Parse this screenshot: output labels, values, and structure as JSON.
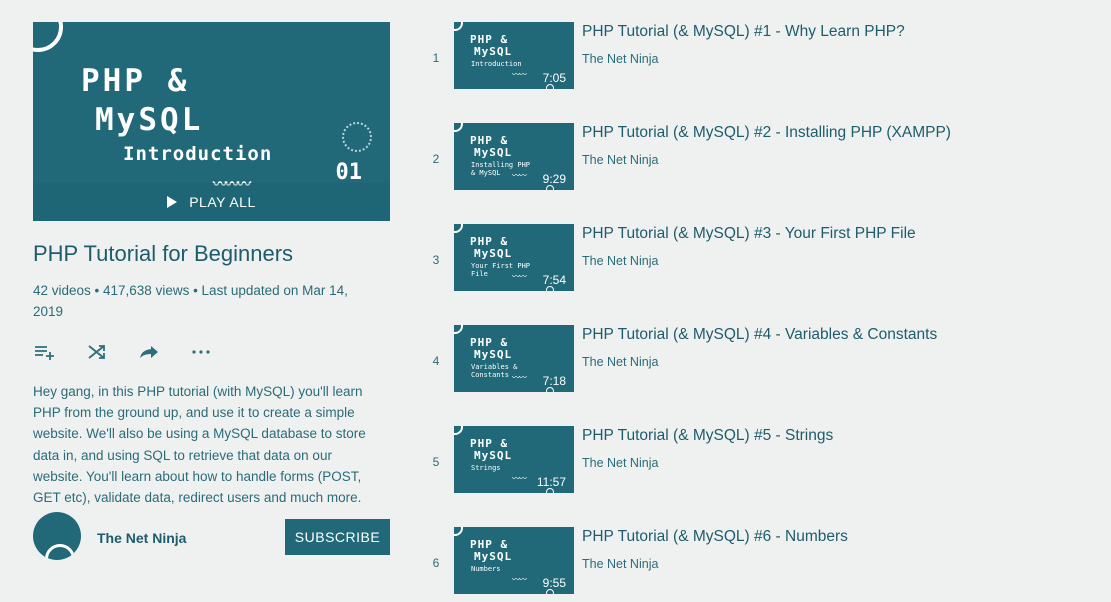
{
  "playlist": {
    "hero": {
      "line1": "PHP &",
      "line2": "MySQL",
      "line3": "Introduction",
      "number": "01",
      "play_all_label": "PLAY ALL"
    },
    "title": "PHP Tutorial for Beginners",
    "meta": "42 videos • 417,638 views • Last updated on Mar 14, 2019",
    "description": "Hey gang, in this PHP tutorial (with MySQL) you'll learn PHP from the ground up, and use it to create a simple website. We'll also be using a MySQL database to store data in, and using SQL to retrieve that data on our website. You'll learn about how to handle forms (POST, GET etc), validate data, redirect users and much more.",
    "actions": [
      {
        "icon": "add-to-queue-icon"
      },
      {
        "icon": "shuffle-icon"
      },
      {
        "icon": "share-icon"
      },
      {
        "icon": "more-icon"
      }
    ],
    "owner": {
      "name": "The Net Ninja",
      "subscribe_label": "SUBSCRIBE"
    }
  },
  "videos": [
    {
      "index": "1",
      "title": "PHP Tutorial (& MySQL) #1 - Why Learn PHP?",
      "channel": "The Net Ninja",
      "thumb_line1": "PHP &",
      "thumb_line2": "MySQL",
      "thumb_sub": "Introduction",
      "duration": "7:05"
    },
    {
      "index": "2",
      "title": "PHP Tutorial (& MySQL) #2 - Installing PHP (XAMPP)",
      "channel": "The Net Ninja",
      "thumb_line1": "PHP &",
      "thumb_line2": "MySQL",
      "thumb_sub": "Installing PHP & MySQL",
      "duration": "9:29"
    },
    {
      "index": "3",
      "title": "PHP Tutorial (& MySQL) #3 - Your First PHP File",
      "channel": "The Net Ninja",
      "thumb_line1": "PHP &",
      "thumb_line2": "MySQL",
      "thumb_sub": "Your First PHP File",
      "duration": "7:54"
    },
    {
      "index": "4",
      "title": "PHP Tutorial (& MySQL) #4 - Variables & Constants",
      "channel": "The Net Ninja",
      "thumb_line1": "PHP &",
      "thumb_line2": "MySQL",
      "thumb_sub": "Variables & Constants",
      "duration": "7:18"
    },
    {
      "index": "5",
      "title": "PHP Tutorial (& MySQL) #5 - Strings",
      "channel": "The Net Ninja",
      "thumb_line1": "PHP &",
      "thumb_line2": "MySQL",
      "thumb_sub": "Strings",
      "duration": "11:57"
    },
    {
      "index": "6",
      "title": "PHP Tutorial (& MySQL) #6 - Numbers",
      "channel": "The Net Ninja",
      "thumb_line1": "PHP &",
      "thumb_line2": "MySQL",
      "thumb_sub": "Numbers",
      "duration": "9:55"
    }
  ],
  "colors": {
    "background": "#eff1f0",
    "accent": "#216979",
    "text": "#1e5c6b"
  }
}
